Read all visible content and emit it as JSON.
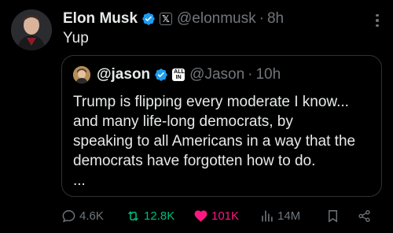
{
  "author": {
    "name": "Elon Musk",
    "handle": "@elonmusk",
    "time": "8h"
  },
  "tweet": {
    "text": "Yup"
  },
  "quoted": {
    "name": "@jason",
    "affiliation_badge": "ALL IN",
    "handle": "@Jason",
    "time": "10h",
    "lines": [
      "Trump is flipping every moderate I know...",
      "and many life-long democrats, by",
      "speaking to all Americans in a way that the",
      "democrats have forgotten how to do.",
      "..."
    ]
  },
  "stats": {
    "replies": "4.6K",
    "reposts": "12.8K",
    "likes": "101K",
    "views": "14M"
  },
  "colors": {
    "background": "#000000",
    "text": "#e7e9ea",
    "muted": "#71767b",
    "verified": "#1d9bf0",
    "repost": "#00ba7c",
    "like": "#f91880",
    "border": "#2f3336"
  },
  "icons": [
    "verified-badge-icon",
    "x-logo-icon",
    "more-icon",
    "reply-icon",
    "repost-icon",
    "like-heart-icon",
    "views-icon",
    "bookmark-icon",
    "share-icon"
  ]
}
